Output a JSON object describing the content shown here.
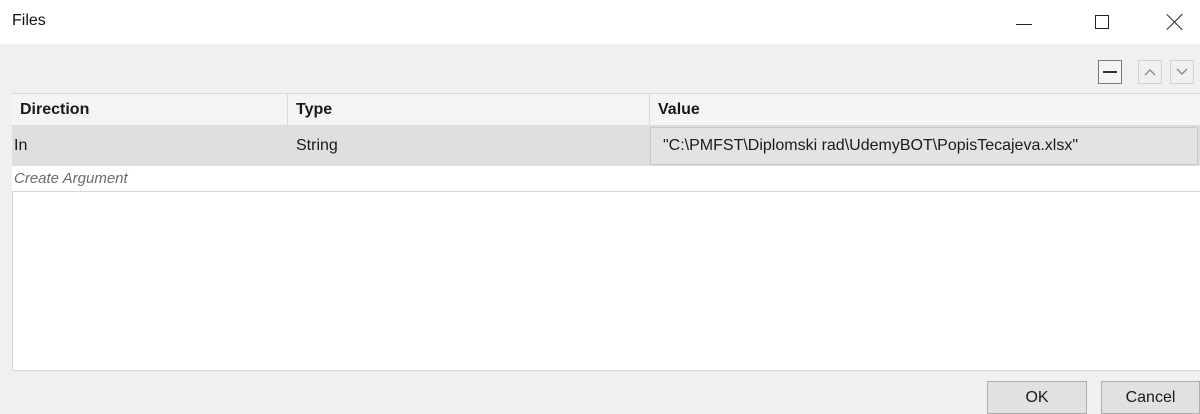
{
  "window": {
    "title": "Files",
    "controls": [
      "minimize-icon",
      "maximize-icon",
      "close-icon"
    ]
  },
  "toolbar": {
    "icons": [
      "remove-icon",
      "move-up-icon",
      "move-down-icon"
    ]
  },
  "grid": {
    "columns": [
      "Direction",
      "Type",
      "Value"
    ],
    "rows": [
      {
        "direction": "In",
        "type": "String",
        "value": "\"C:\\PMFST\\Diplomski rad\\UdemyBOT\\PopisTecajeva.xlsx\""
      }
    ],
    "create_argument": "Create Argument"
  },
  "buttons": {
    "ok": "OK",
    "cancel": "Cancel"
  }
}
